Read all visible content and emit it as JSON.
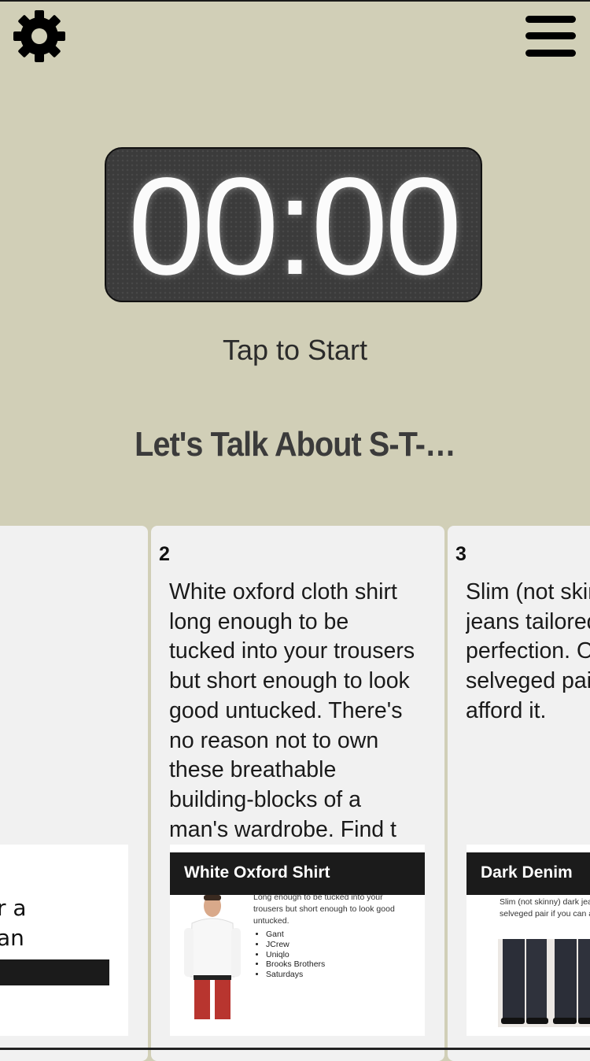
{
  "header": {
    "settings_icon": "gear-icon",
    "menu_icon": "hamburger-menu-icon"
  },
  "timer": {
    "display": "00:00",
    "prompt": "Tap to Start"
  },
  "topic": {
    "title": "Let's Talk About S-T-…"
  },
  "cards": [
    {
      "thumb_lines": [
        "r a",
        "an"
      ]
    },
    {
      "number": "2",
      "text": "White oxford cloth shirt long enough to be tucked into your trousers but short enough to look good untucked. There's no reason not to own these breathable building-blocks of a man's wardrobe. Find t",
      "thumb_title": "White Oxford Shirt",
      "thumb_desc": "Long enough to be tucked into your trousers but short enough to look good untucked.",
      "thumb_brands": [
        "Gant",
        "JCrew",
        "Uniqlo",
        "Brooks Brothers",
        "Saturdays"
      ]
    },
    {
      "number": "3",
      "text": "Slim (not skinny) dark jeans tailored to perfection. Opt for a selveged pair if you can afford it.",
      "thumb_title": "Dark Denim",
      "thumb_desc": "Slim (not skinny) dark jeans tailored to perfection. Opt for a selveged pair if you can afford it."
    }
  ],
  "colors": {
    "background": "#d1cfb7",
    "timer_bg": "#3b3b3b",
    "card_bg": "#f1f1f1"
  }
}
